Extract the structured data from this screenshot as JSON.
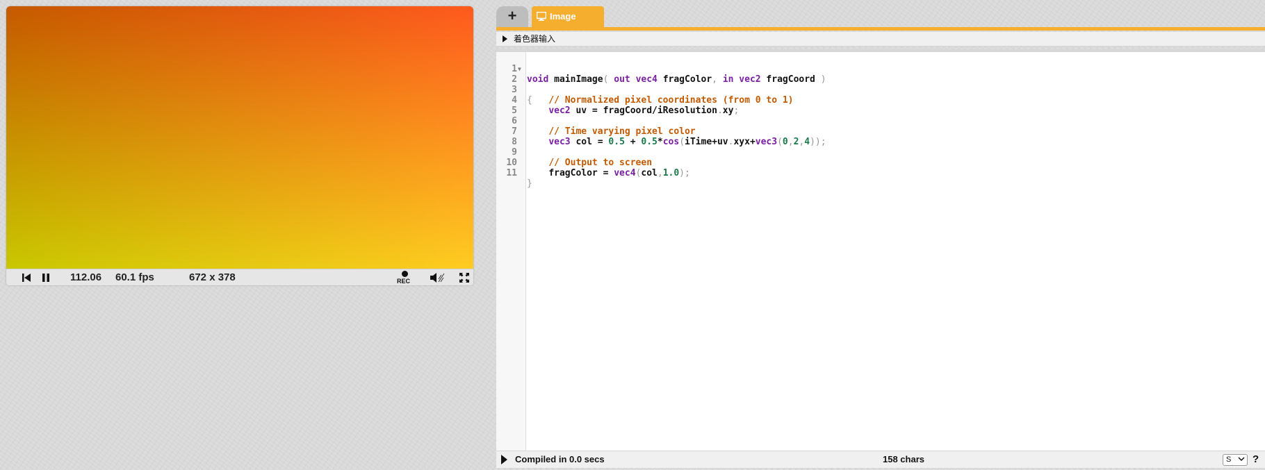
{
  "player": {
    "time": "112.06",
    "fps": "60.1 fps",
    "resolution": "672 x 378",
    "rec_label": "REC",
    "icons": [
      "rewind-icon",
      "pause-icon",
      "record-icon",
      "volume-icon",
      "fullscreen-icon"
    ],
    "gradient_colors": {
      "top_left": "#c65a00",
      "top_right": "#ff5a1e",
      "bottom_left": "#c8c800",
      "bottom_right": "#ffcc22"
    }
  },
  "editor": {
    "add_tab_label": "+",
    "active_tab_label": "Image",
    "inputs_label": "着色器输入",
    "accent_color": "#f5ae2e",
    "code_lines": [
      {
        "n": "1",
        "fold": false
      },
      {
        "n": "2",
        "fold": true
      },
      {
        "n": "3",
        "fold": false
      },
      {
        "n": "4",
        "fold": false
      },
      {
        "n": "5",
        "fold": false
      },
      {
        "n": "6",
        "fold": false
      },
      {
        "n": "7",
        "fold": false
      },
      {
        "n": "8",
        "fold": false
      },
      {
        "n": "9",
        "fold": false
      },
      {
        "n": "10",
        "fold": false
      },
      {
        "n": "11",
        "fold": false
      }
    ],
    "code": {
      "l1": {
        "kw_void": "void",
        "fn_name": " mainImage",
        "p1": "( ",
        "kw_out": "out",
        "sp1": " ",
        "t_vec4": "vec4",
        "arg1": " fragColor",
        "comma": ", ",
        "kw_in": "in",
        "sp2": " ",
        "t_vec2": "vec2",
        "arg2": " fragCoord",
        "p2": " )"
      },
      "l2": {
        "brace": "{"
      },
      "l3": {
        "indent": "    ",
        "comment": "// Normalized pixel coordinates (from 0 to 1)"
      },
      "l4": {
        "indent": "    ",
        "t": "vec2",
        "rest1": " uv = fragCoord/iResolution",
        "dot": ".",
        "rest2": "xy",
        "semi": ";"
      },
      "l5": {
        "text": ""
      },
      "l6": {
        "indent": "    ",
        "comment": "// Time varying pixel color"
      },
      "l7": {
        "indent": "    ",
        "t": "vec3",
        "a": " col = ",
        "n1": "0.5",
        "b": " + ",
        "n2": "0.5",
        "c": "*",
        "fn": "cos",
        "p1": "(",
        "d": "iTime+uv",
        "dot": ".",
        "e": "xyx+",
        "t2": "vec3",
        "p2": "(",
        "n3": "0",
        "cm1": ",",
        "n4": "2",
        "cm2": ",",
        "n5": "4",
        "p3": "))",
        "semi": ";"
      },
      "l8": {
        "text": ""
      },
      "l9": {
        "indent": "    ",
        "comment": "// Output to screen"
      },
      "l10": {
        "indent": "    ",
        "a": "fragColor = ",
        "t": "vec4",
        "p1": "(",
        "b": "col",
        "cm": ",",
        "n": "1.0",
        "p2": ")",
        "semi": ";"
      },
      "l11": {
        "brace": "}"
      }
    },
    "status": {
      "compile": "Compiled in 0.0 secs",
      "chars": "158 chars",
      "select_value": "S",
      "help": "?"
    }
  }
}
